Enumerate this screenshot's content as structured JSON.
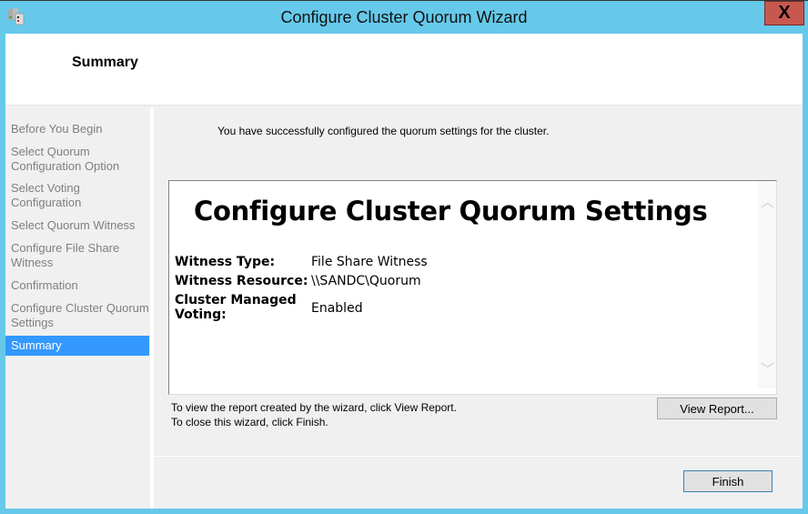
{
  "window": {
    "title": "Configure Cluster Quorum Wizard",
    "close_label": "X"
  },
  "header": {
    "title": "Summary"
  },
  "sidebar": {
    "items": [
      {
        "label": "Before You Begin"
      },
      {
        "label": "Select Quorum Configuration Option"
      },
      {
        "label": "Select Voting Configuration"
      },
      {
        "label": "Select Quorum Witness"
      },
      {
        "label": "Configure File Share Witness"
      },
      {
        "label": "Confirmation"
      },
      {
        "label": "Configure Cluster Quorum Settings"
      },
      {
        "label": "Summary",
        "active": true
      }
    ]
  },
  "main": {
    "message": "You have successfully configured the quorum settings for the cluster.",
    "report": {
      "title": "Configure Cluster Quorum Settings",
      "rows": [
        {
          "key": "Witness Type:",
          "value": "File Share Witness"
        },
        {
          "key": "Witness Resource:",
          "value": "\\\\SANDC\\Quorum"
        },
        {
          "key": "Cluster Managed Voting:",
          "value": "Enabled"
        }
      ]
    },
    "hint1": "To view the report created by the wizard, click View Report.",
    "hint2": "To close this wizard, click Finish.",
    "view_report_label": "View Report...",
    "finish_label": "Finish"
  },
  "colors": {
    "frame": "#66c9ea",
    "close": "#c75850",
    "selection": "#3399ff"
  }
}
